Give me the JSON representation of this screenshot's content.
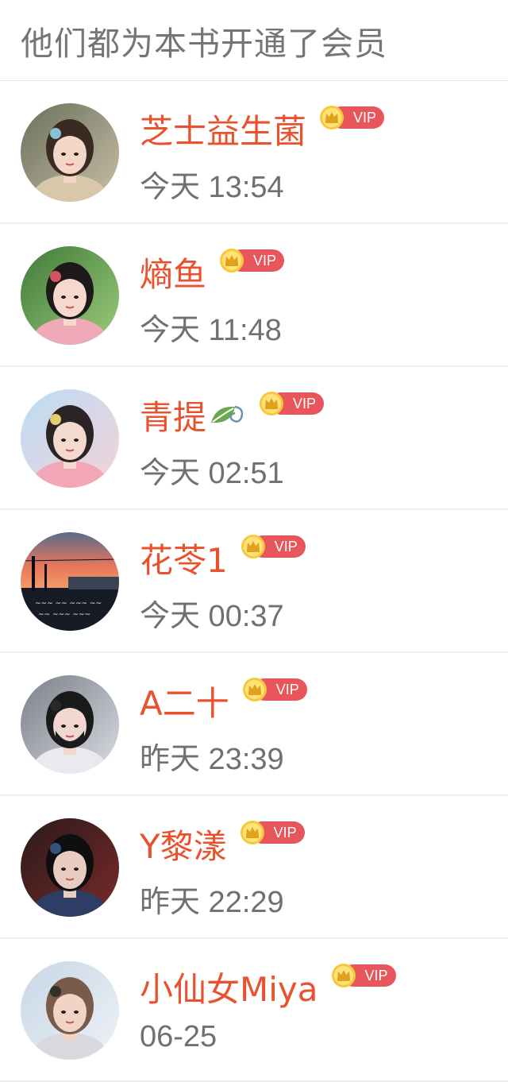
{
  "header": {
    "title": "他们都为本书开通了会员"
  },
  "vip_label": "VIP",
  "members": [
    {
      "name": "芝士益生菌",
      "time": "今天 13:54",
      "has_leaf": false
    },
    {
      "name": "熵鱼",
      "time": "今天 11:48",
      "has_leaf": false
    },
    {
      "name": "青提",
      "time": "今天 02:51",
      "has_leaf": true
    },
    {
      "name": "花苓1",
      "time": "今天 00:37",
      "has_leaf": false
    },
    {
      "name": "A二十",
      "time": "昨天 23:39",
      "has_leaf": false
    },
    {
      "name": "Y黎漾",
      "time": "昨天 22:29",
      "has_leaf": false
    },
    {
      "name": "小仙女Miya",
      "time": "06-25",
      "has_leaf": false
    }
  ]
}
